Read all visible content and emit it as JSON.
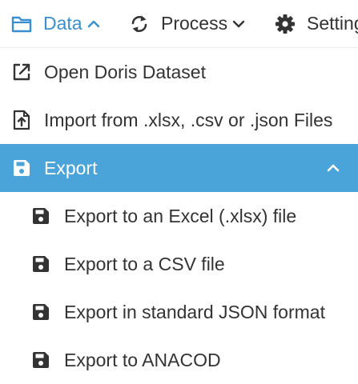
{
  "menubar": {
    "data_label": "Data",
    "process_label": "Process",
    "settings_label": "Settings"
  },
  "dropdown": {
    "open_dataset": "Open Doris Dataset",
    "import_files": "Import from .xlsx, .csv or .json Files",
    "export": {
      "label": "Export",
      "items": [
        "Export to an Excel (.xlsx) file",
        "Export to a CSV file",
        "Export in standard JSON format",
        "Export to ANACOD"
      ]
    }
  },
  "colors": {
    "accent": "#3a8fd0",
    "highlight_bg": "#4aa3d9",
    "text": "#333333",
    "highlight_text": "#ffffff"
  },
  "icons": {
    "data": "folder-icon",
    "process": "sync-icon",
    "settings": "gear-icon",
    "open": "external-link-icon",
    "import": "file-upload-icon",
    "export": "save-icon"
  }
}
